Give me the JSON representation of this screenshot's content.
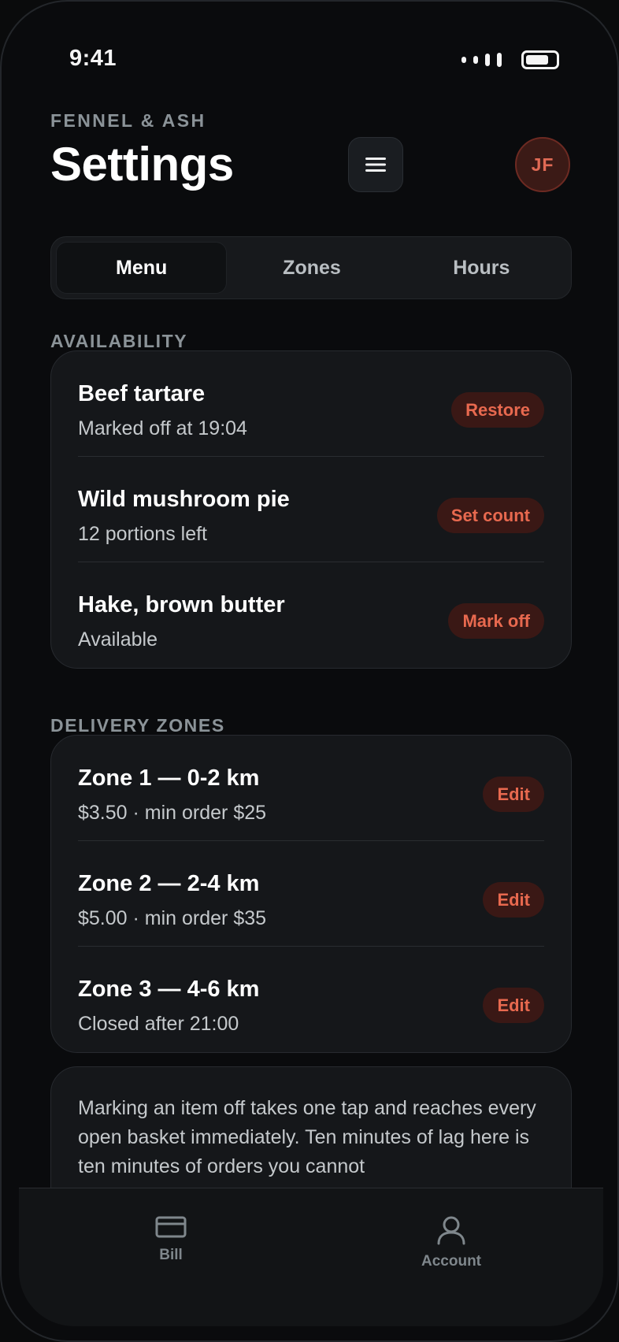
{
  "status_bar": {
    "time": "9:41"
  },
  "header": {
    "brand": "FENNEL & ASH",
    "title": "Settings",
    "avatar_initials": "JF"
  },
  "tabs": [
    {
      "label": "Menu",
      "active": true
    },
    {
      "label": "Zones",
      "active": false
    },
    {
      "label": "Hours",
      "active": false
    }
  ],
  "availability": {
    "label": "AVAILABILITY",
    "items": [
      {
        "title": "Beef tartare",
        "subtitle": "Marked off at 19:04",
        "action": "Restore"
      },
      {
        "title": "Wild mushroom pie",
        "subtitle": "12 portions left",
        "action": "Set count"
      },
      {
        "title": "Hake, brown butter",
        "subtitle": "Available",
        "action": "Mark off"
      }
    ]
  },
  "delivery_zones": {
    "label": "DELIVERY ZONES",
    "items": [
      {
        "title": "Zone 1 — 0-2 km",
        "subtitle": "$3.50 · min order $25",
        "action": "Edit"
      },
      {
        "title": "Zone 2 — 2-4 km",
        "subtitle": "$5.00 · min order $35",
        "action": "Edit"
      },
      {
        "title": "Zone 3 — 4-6 km",
        "subtitle": "Closed after 21:00",
        "action": "Edit"
      }
    ]
  },
  "note": {
    "text": "Marking an item off takes one tap and reaches every open basket immediately. Ten minutes of lag here is ten minutes of orders you cannot"
  },
  "bottom_nav": {
    "items": [
      {
        "label": "Bill",
        "icon": "card-icon"
      },
      {
        "label": "Account",
        "icon": "user-icon"
      }
    ]
  },
  "colors": {
    "accent": "#e8694f",
    "pill_bg": "#3a1815",
    "background": "#0a0b0d",
    "card": "#15171a"
  }
}
